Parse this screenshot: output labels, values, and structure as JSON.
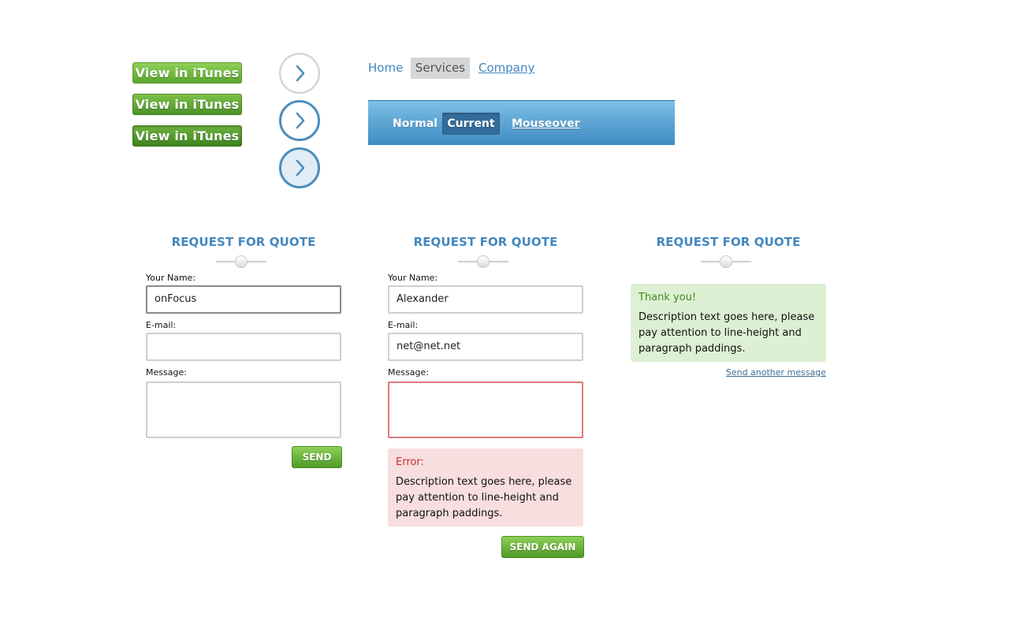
{
  "itunes_buttons": {
    "normal_label": "View in iTunes",
    "hover_label": "View in iTunes",
    "active_label": "View in iTunes"
  },
  "top_nav": {
    "items": [
      {
        "label": "Home"
      },
      {
        "label": "Services"
      },
      {
        "label": "Company"
      }
    ]
  },
  "blue_nav": {
    "items": [
      {
        "label": "Normal"
      },
      {
        "label": "Current"
      },
      {
        "label": "Mouseover"
      }
    ]
  },
  "forms": [
    {
      "title": "REQUEST FOR QUOTE",
      "name_label": "Your Name:",
      "name_value": "onFocus",
      "email_label": "E-mail:",
      "email_value": "",
      "message_label": "Message:",
      "message_value": "",
      "button_label": "SEND"
    },
    {
      "title": "REQUEST FOR QUOTE",
      "name_label": "Your Name:",
      "name_value": "Alexander",
      "email_label": "E-mail:",
      "email_value": "net@net.net",
      "message_label": "Message:",
      "message_value": "",
      "error_title": "Error:",
      "error_text": "Description text goes here, please pay attention to line-height and paragraph paddings.",
      "button_label": "SEND AGAIN"
    },
    {
      "title": "REQUEST FOR QUOTE",
      "success_title": "Thank you!",
      "success_text": "Description text goes here, please pay attention to line-height and paragraph paddings.",
      "link_label": "Send another message"
    }
  ],
  "colors": {
    "accent_blue": "#4387bf",
    "button_green": "#5aa62e",
    "error_bg": "#f8dede",
    "success_bg": "#def0d3"
  }
}
